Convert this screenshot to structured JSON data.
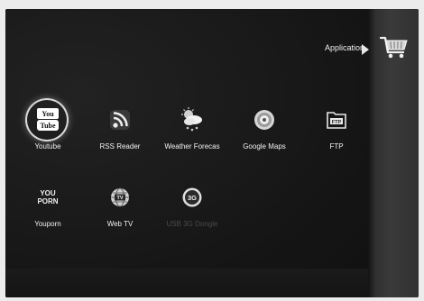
{
  "header": {
    "category_label": "Application"
  },
  "apps": [
    {
      "label": "Youtube",
      "icon": "youtube-icon",
      "selected": true,
      "disabled": false
    },
    {
      "label": "RSS Reader",
      "icon": "rss-icon",
      "selected": false,
      "disabled": false
    },
    {
      "label": "Weather Forecas",
      "icon": "weather-icon",
      "selected": false,
      "disabled": false
    },
    {
      "label": "Google Maps",
      "icon": "google-maps-icon",
      "selected": false,
      "disabled": false
    },
    {
      "label": "FTP",
      "icon": "ftp-folder-icon",
      "selected": false,
      "disabled": false
    },
    {
      "label": "Youporn",
      "icon": "youporn-icon",
      "selected": false,
      "disabled": false
    },
    {
      "label": "Web TV",
      "icon": "web-tv-icon",
      "selected": false,
      "disabled": false
    },
    {
      "label": "USB 3G Dongle",
      "icon": "usb-3g-dongle-icon",
      "selected": false,
      "disabled": true
    }
  ],
  "icons": {
    "ftp_text": "FTP",
    "tv_text": "TV",
    "youtube_top": "You",
    "youtube_bottom": "Tube",
    "youporn_top": "YOU",
    "youporn_bottom": "PORN",
    "dongle_text": "3G"
  },
  "side_panel": {
    "icon": "shopping-cart-icon"
  }
}
